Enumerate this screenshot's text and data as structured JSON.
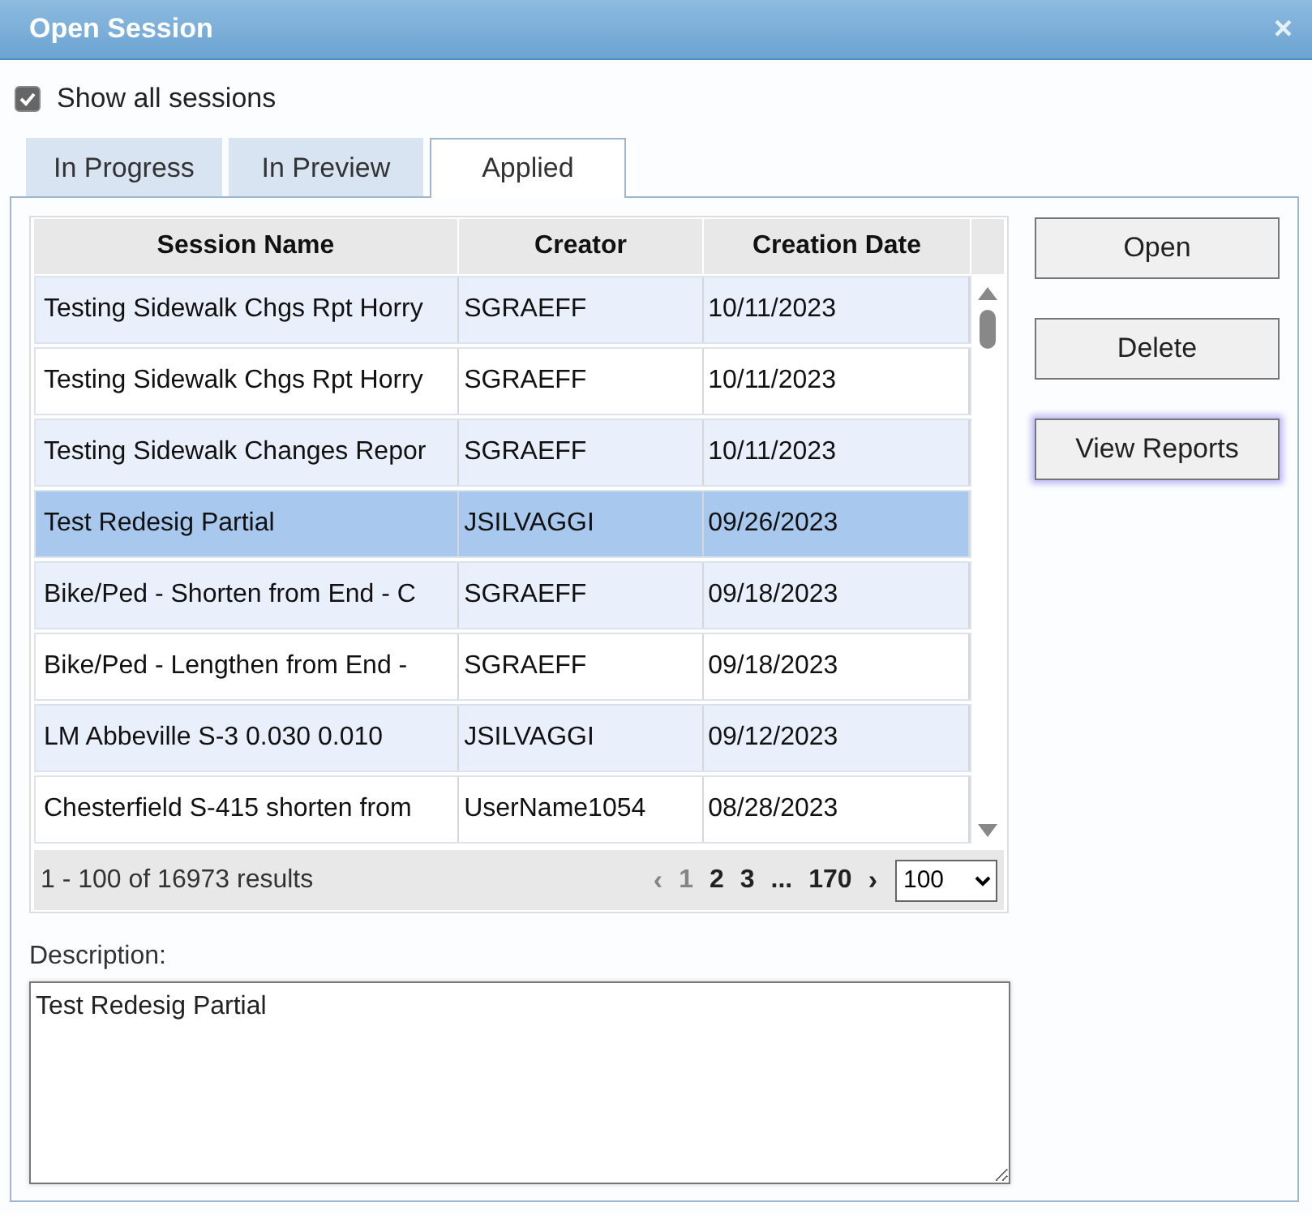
{
  "window": {
    "title": "Open Session",
    "close": "×"
  },
  "show_all": {
    "label": "Show all sessions",
    "checked": true
  },
  "tabs": [
    {
      "label": "In Progress",
      "selected": false
    },
    {
      "label": "In Preview",
      "selected": false
    },
    {
      "label": "Applied",
      "selected": true
    }
  ],
  "table": {
    "columns": [
      "Session Name",
      "Creator",
      "Creation Date"
    ],
    "rows": [
      {
        "cells": [
          "Testing Sidewalk Chgs Rpt Horry",
          "SGRAEFF",
          "10/11/2023"
        ],
        "selected": false
      },
      {
        "cells": [
          "Testing Sidewalk Chgs Rpt Horry",
          "SGRAEFF",
          "10/11/2023"
        ],
        "selected": false
      },
      {
        "cells": [
          "Testing Sidewalk Changes Repor",
          "SGRAEFF",
          "10/11/2023"
        ],
        "selected": false
      },
      {
        "cells": [
          "Test Redesig Partial",
          "JSILVAGGI",
          "09/26/2023"
        ],
        "selected": true
      },
      {
        "cells": [
          "Bike/Ped - Shorten from End - C",
          "SGRAEFF",
          "09/18/2023"
        ],
        "selected": false
      },
      {
        "cells": [
          "Bike/Ped - Lengthen from End -",
          "SGRAEFF",
          "09/18/2023"
        ],
        "selected": false
      },
      {
        "cells": [
          "LM Abbeville S-3 0.030 0.010",
          "JSILVAGGI",
          "09/12/2023"
        ],
        "selected": false
      },
      {
        "cells": [
          "Chesterfield S-415 shorten from",
          "UserName1054",
          "08/28/2023"
        ],
        "selected": false
      }
    ]
  },
  "pager": {
    "summary": "1 - 100 of 16973 results",
    "prev": "‹",
    "next": "›",
    "pages": [
      {
        "label": "1",
        "selected": true
      },
      {
        "label": "2",
        "selected": false
      },
      {
        "label": "3",
        "selected": false
      },
      {
        "label": "...",
        "selected": false
      },
      {
        "label": "170",
        "selected": false
      }
    ],
    "page_size": "100"
  },
  "buttons": [
    {
      "label": "Open",
      "focused": false
    },
    {
      "label": "Delete",
      "focused": false
    },
    {
      "label": "View Reports",
      "focused": true
    }
  ],
  "description": {
    "label": "Description:",
    "value": "Test Redesig Partial"
  }
}
